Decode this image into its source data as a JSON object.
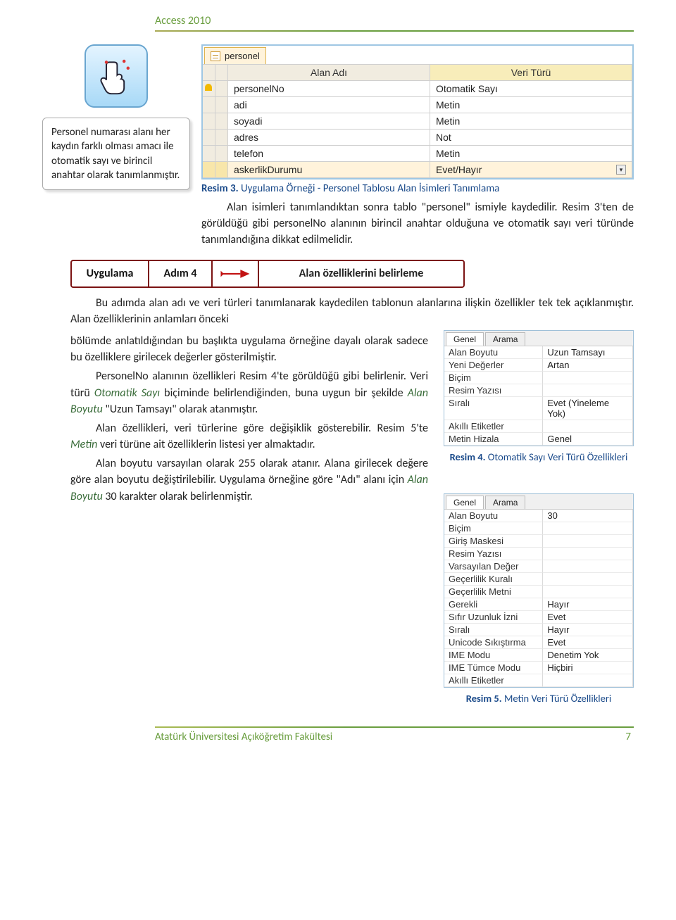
{
  "header": {
    "title": "Access 2010"
  },
  "callout": {
    "text": "Personel numarası alanı her kaydın farklı olması amacı ile otomatik sayı ve birincil anahtar olarak tanımlanmıştır."
  },
  "grid": {
    "tab_label": "personel",
    "head": {
      "c1": "Alan Adı",
      "c2": "Veri Türü"
    },
    "rows": [
      {
        "name": "personelNo",
        "type": "Otomatik Sayı",
        "pk": true
      },
      {
        "name": "adi",
        "type": "Metin"
      },
      {
        "name": "soyadi",
        "type": "Metin"
      },
      {
        "name": "adres",
        "type": "Not"
      },
      {
        "name": "telefon",
        "type": "Metin"
      },
      {
        "name": "askerlikDurumu",
        "type": "Evet/Hayır",
        "sel": true
      }
    ]
  },
  "caption3": {
    "label": "Resim 3.",
    "text": " Uygulama Örneği - Personel Tablosu Alan İsimleri Tanımlama"
  },
  "para1": "Alan isimleri tanımlandıktan sonra tablo \"personel\" ismiyle kaydedilir. Resim 3'ten de görüldüğü gibi personelNo alanının birincil anahtar olduğuna ve otomatik sayı veri türünde tanımlandığına dikkat edilmelidir.",
  "ribbon": {
    "c1": "Uygulama",
    "c2": "Adım 4",
    "c4": "Alan özelliklerini belirleme"
  },
  "para2_a": "Bu adımda alan adı ve veri türleri tanımlanarak kaydedilen tablonun alanlarına ilişkin özellikler tek tek açıklanmıştır. Alan özelliklerinin anlamları önceki",
  "para2_b": "bölümde anlatıldığından bu başlıkta uygulama örneğine dayalı olarak sadece bu özelliklere girilecek değerler gösterilmiştir.",
  "para3_a": "PersonelNo alanının özellikleri Resim 4'te görüldüğü gibi belirlenir. Veri türü ",
  "para3_ital1": "Otomatik Sayı",
  "para3_b": " biçiminde belirlendiğinden, buna uygun bir şekilde ",
  "para3_ital2": "Alan Boyutu",
  "para3_c": " \"Uzun Tamsayı\" olarak atanmıştır.",
  "para4_a": "Alan özellikleri, veri türlerine göre değişiklik gösterebilir. Resim 5'te ",
  "para4_ital": "Metin",
  "para4_b": " veri türüne ait özelliklerin listesi yer almaktadır.",
  "para5_a": "Alan boyutu varsayılan olarak 255 olarak atanır. Alana girilecek değere göre alan boyutu değiştirilebilir. Uygulama örneğine göre \"Adı\" alanı için ",
  "para5_ital": "Alan Boyutu",
  "para5_b": " 30 karakter olarak belirlenmiştir.",
  "props4": {
    "tabs": {
      "a": "Genel",
      "b": "Arama"
    },
    "rows": [
      {
        "k": "Alan Boyutu",
        "v": "Uzun Tamsayı"
      },
      {
        "k": "Yeni Değerler",
        "v": "Artan"
      },
      {
        "k": "Biçim",
        "v": ""
      },
      {
        "k": "Resim Yazısı",
        "v": ""
      },
      {
        "k": "Sıralı",
        "v": "Evet (Yineleme Yok)"
      },
      {
        "k": "Akıllı Etiketler",
        "v": ""
      },
      {
        "k": "Metin Hizala",
        "v": "Genel"
      }
    ]
  },
  "caption4": {
    "label": "Resim 4.",
    "text": " Otomatik Sayı Veri Türü Özellikleri"
  },
  "props5": {
    "tabs": {
      "a": "Genel",
      "b": "Arama"
    },
    "rows": [
      {
        "k": "Alan Boyutu",
        "v": "30"
      },
      {
        "k": "Biçim",
        "v": ""
      },
      {
        "k": "Giriş Maskesi",
        "v": ""
      },
      {
        "k": "Resim Yazısı",
        "v": ""
      },
      {
        "k": "Varsayılan Değer",
        "v": ""
      },
      {
        "k": "Geçerlilik Kuralı",
        "v": ""
      },
      {
        "k": "Geçerlilik Metni",
        "v": ""
      },
      {
        "k": "Gerekli",
        "v": "Hayır"
      },
      {
        "k": "Sıfır Uzunluk İzni",
        "v": "Evet"
      },
      {
        "k": "Sıralı",
        "v": "Hayır"
      },
      {
        "k": "Unicode Sıkıştırma",
        "v": "Evet"
      },
      {
        "k": "IME Modu",
        "v": "Denetim Yok"
      },
      {
        "k": "IME Tümce Modu",
        "v": "Hiçbiri"
      },
      {
        "k": "Akıllı Etiketler",
        "v": ""
      }
    ]
  },
  "caption5": {
    "label": "Resim 5.",
    "text": " Metin Veri Türü Özellikleri"
  },
  "footer": {
    "left": "Atatürk Üniversitesi Açıköğretim Fakültesi",
    "right": "7"
  },
  "chart_data": {
    "type": "table",
    "title": "personel — Alan Adı / Veri Türü",
    "categories": [
      "personelNo",
      "adi",
      "soyadi",
      "adres",
      "telefon",
      "askerlikDurumu"
    ],
    "values": [
      "Otomatik Sayı",
      "Metin",
      "Metin",
      "Not",
      "Metin",
      "Evet/Hayır"
    ]
  }
}
